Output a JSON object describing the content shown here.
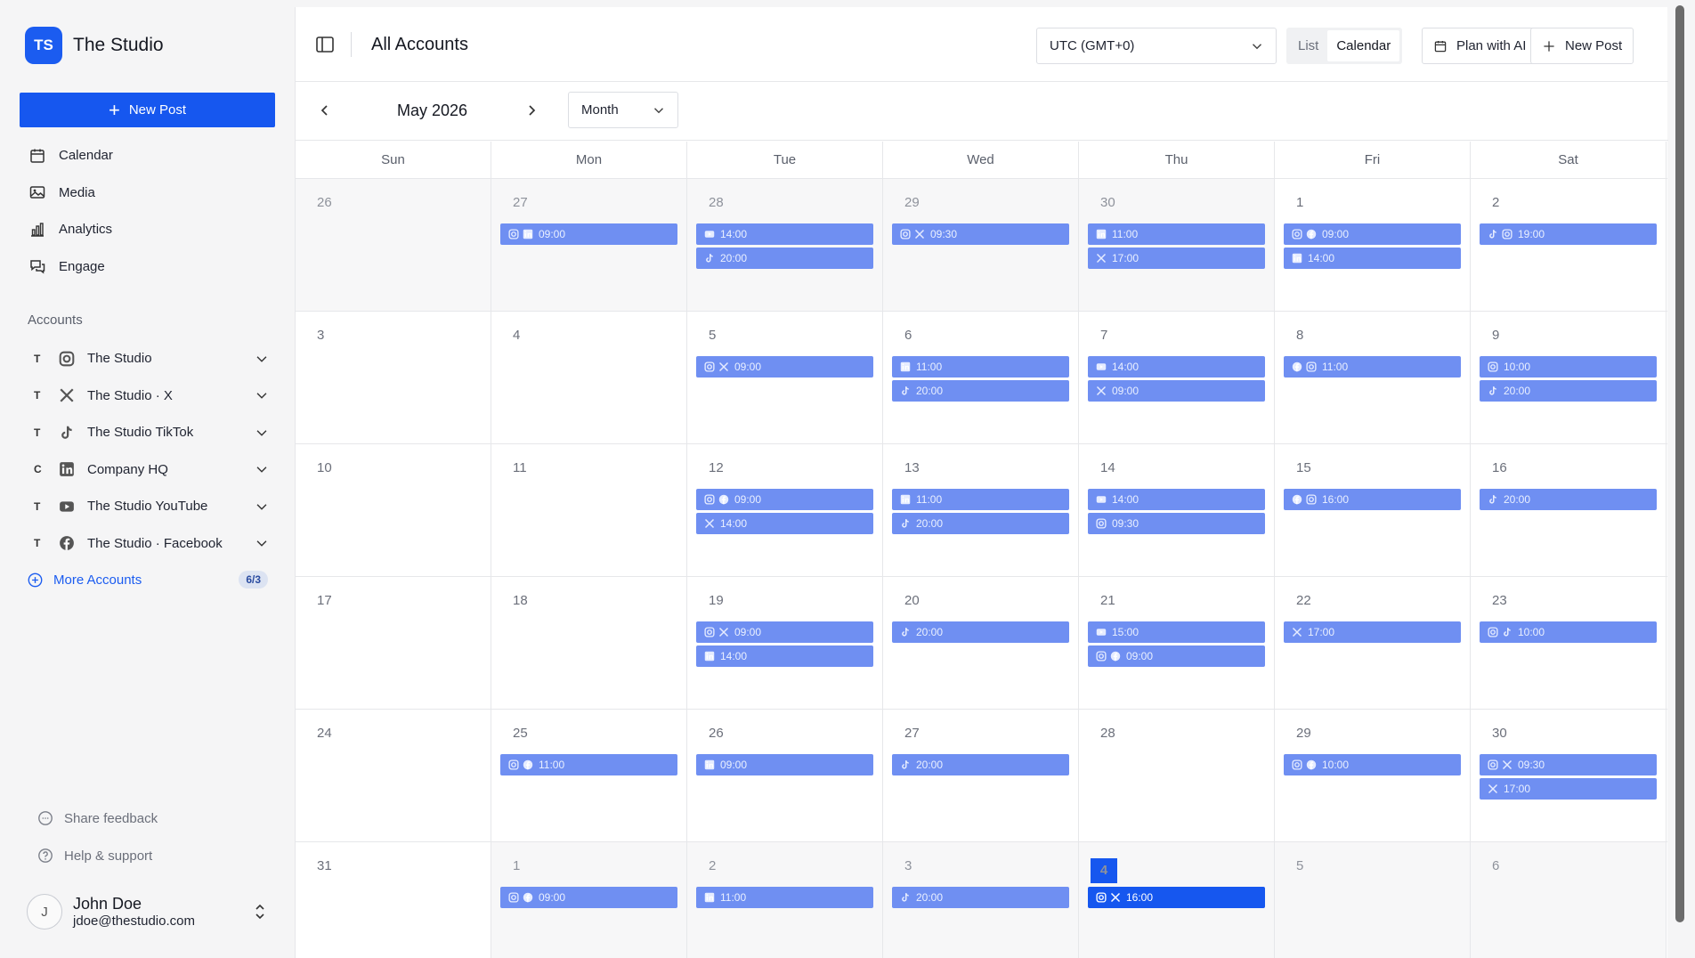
{
  "brand": {
    "initials": "TS",
    "name": "The Studio"
  },
  "sidebar": {
    "new_post_label": "New Post",
    "nav": [
      {
        "label": "Calendar",
        "icon": "calendar-icon"
      },
      {
        "label": "Media",
        "icon": "image-icon"
      },
      {
        "label": "Analytics",
        "icon": "bar-chart-icon"
      },
      {
        "label": "Engage",
        "icon": "chat-icon"
      }
    ],
    "accounts_title": "Accounts",
    "accounts": [
      {
        "letter": "T",
        "platform": "instagram",
        "name": "The Studio"
      },
      {
        "letter": "T",
        "platform": "x",
        "name": "The Studio · X"
      },
      {
        "letter": "T",
        "platform": "tiktok",
        "name": "The Studio TikTok"
      },
      {
        "letter": "C",
        "platform": "linkedin",
        "name": "Company HQ"
      },
      {
        "letter": "T",
        "platform": "youtube",
        "name": "The Studio YouTube"
      },
      {
        "letter": "T",
        "platform": "facebook",
        "name": "The Studio · Facebook"
      }
    ],
    "more_accounts_label": "More Accounts",
    "more_accounts_count": "6/3",
    "share_feedback": "Share feedback",
    "help_support": "Help & support",
    "user": {
      "initial": "J",
      "name": "John Doe",
      "email": "jdoe@thestudio.com"
    }
  },
  "header": {
    "title": "All Accounts",
    "timezone": "UTC (GMT+0)",
    "view_list": "List",
    "view_calendar": "Calendar",
    "plan_ai_label": "Plan with AI",
    "new_post_label": "New Post"
  },
  "toolbar": {
    "month_label": "May 2026",
    "range": "Month"
  },
  "calendar": {
    "days_of_week": [
      "Sun",
      "Mon",
      "Tue",
      "Wed",
      "Thu",
      "Fri",
      "Sat"
    ],
    "weeks": [
      [
        {
          "n": "26",
          "muted": true,
          "events": []
        },
        {
          "n": "27",
          "muted": true,
          "events": [
            {
              "p": [
                "instagram",
                "linkedin"
              ],
              "t": "09:00"
            }
          ]
        },
        {
          "n": "28",
          "muted": true,
          "events": [
            {
              "p": [
                "youtube"
              ],
              "t": "14:00"
            },
            {
              "p": [
                "tiktok"
              ],
              "t": "20:00"
            }
          ]
        },
        {
          "n": "29",
          "muted": true,
          "events": [
            {
              "p": [
                "instagram",
                "x"
              ],
              "t": "09:30"
            }
          ]
        },
        {
          "n": "30",
          "muted": true,
          "events": [
            {
              "p": [
                "linkedin"
              ],
              "t": "11:00"
            },
            {
              "p": [
                "x"
              ],
              "t": "17:00"
            }
          ]
        },
        {
          "n": "1",
          "events": [
            {
              "p": [
                "instagram",
                "facebook"
              ],
              "t": "09:00"
            },
            {
              "p": [
                "linkedin"
              ],
              "t": "14:00"
            }
          ]
        },
        {
          "n": "2",
          "events": [
            {
              "p": [
                "tiktok",
                "instagram"
              ],
              "t": "19:00"
            }
          ]
        }
      ],
      [
        {
          "n": "3",
          "events": []
        },
        {
          "n": "4",
          "events": []
        },
        {
          "n": "5",
          "events": [
            {
              "p": [
                "instagram",
                "x"
              ],
              "t": "09:00"
            }
          ]
        },
        {
          "n": "6",
          "events": [
            {
              "p": [
                "linkedin"
              ],
              "t": "11:00"
            },
            {
              "p": [
                "tiktok"
              ],
              "t": "20:00"
            }
          ]
        },
        {
          "n": "7",
          "events": [
            {
              "p": [
                "youtube"
              ],
              "t": "14:00"
            },
            {
              "p": [
                "x"
              ],
              "t": "09:00"
            }
          ]
        },
        {
          "n": "8",
          "events": [
            {
              "p": [
                "facebook",
                "instagram"
              ],
              "t": "11:00"
            }
          ]
        },
        {
          "n": "9",
          "events": [
            {
              "p": [
                "instagram"
              ],
              "t": "10:00"
            },
            {
              "p": [
                "tiktok"
              ],
              "t": "20:00"
            }
          ]
        }
      ],
      [
        {
          "n": "10",
          "events": []
        },
        {
          "n": "11",
          "events": []
        },
        {
          "n": "12",
          "events": [
            {
              "p": [
                "instagram",
                "facebook"
              ],
              "t": "09:00"
            },
            {
              "p": [
                "x"
              ],
              "t": "14:00"
            }
          ]
        },
        {
          "n": "13",
          "events": [
            {
              "p": [
                "linkedin"
              ],
              "t": "11:00"
            },
            {
              "p": [
                "tiktok"
              ],
              "t": "20:00"
            }
          ]
        },
        {
          "n": "14",
          "events": [
            {
              "p": [
                "youtube"
              ],
              "t": "14:00"
            },
            {
              "p": [
                "instagram"
              ],
              "t": "09:30"
            }
          ]
        },
        {
          "n": "15",
          "events": [
            {
              "p": [
                "facebook",
                "instagram"
              ],
              "t": "16:00"
            }
          ]
        },
        {
          "n": "16",
          "events": [
            {
              "p": [
                "tiktok"
              ],
              "t": "20:00"
            }
          ]
        }
      ],
      [
        {
          "n": "17",
          "events": []
        },
        {
          "n": "18",
          "events": []
        },
        {
          "n": "19",
          "events": [
            {
              "p": [
                "instagram",
                "x"
              ],
              "t": "09:00"
            },
            {
              "p": [
                "linkedin"
              ],
              "t": "14:00"
            }
          ]
        },
        {
          "n": "20",
          "events": [
            {
              "p": [
                "tiktok"
              ],
              "t": "20:00"
            }
          ]
        },
        {
          "n": "21",
          "events": [
            {
              "p": [
                "youtube"
              ],
              "t": "15:00"
            },
            {
              "p": [
                "instagram",
                "facebook"
              ],
              "t": "09:00"
            }
          ]
        },
        {
          "n": "22",
          "events": [
            {
              "p": [
                "x"
              ],
              "t": "17:00"
            }
          ]
        },
        {
          "n": "23",
          "events": [
            {
              "p": [
                "instagram",
                "tiktok"
              ],
              "t": "10:00"
            }
          ]
        }
      ],
      [
        {
          "n": "24",
          "events": []
        },
        {
          "n": "25",
          "events": [
            {
              "p": [
                "instagram",
                "facebook"
              ],
              "t": "11:00"
            }
          ]
        },
        {
          "n": "26",
          "events": [
            {
              "p": [
                "linkedin"
              ],
              "t": "09:00"
            }
          ]
        },
        {
          "n": "27",
          "events": [
            {
              "p": [
                "tiktok"
              ],
              "t": "20:00"
            }
          ]
        },
        {
          "n": "28",
          "events": []
        },
        {
          "n": "29",
          "events": [
            {
              "p": [
                "instagram",
                "facebook"
              ],
              "t": "10:00"
            }
          ]
        },
        {
          "n": "30",
          "events": [
            {
              "p": [
                "instagram",
                "x"
              ],
              "t": "09:30"
            },
            {
              "p": [
                "x"
              ],
              "t": "17:00"
            }
          ]
        }
      ],
      [
        {
          "n": "31",
          "events": []
        },
        {
          "n": "1",
          "muted": true,
          "events": [
            {
              "p": [
                "instagram",
                "facebook"
              ],
              "t": "09:00"
            }
          ]
        },
        {
          "n": "2",
          "muted": true,
          "events": [
            {
              "p": [
                "linkedin"
              ],
              "t": "11:00"
            }
          ]
        },
        {
          "n": "3",
          "muted": true,
          "events": [
            {
              "p": [
                "tiktok"
              ],
              "t": "20:00"
            }
          ]
        },
        {
          "n": "4",
          "muted": true,
          "today": true,
          "events": [
            {
              "p": [
                "instagram",
                "x"
              ],
              "t": "16:00",
              "current": true
            }
          ]
        },
        {
          "n": "5",
          "muted": true,
          "events": []
        },
        {
          "n": "6",
          "muted": true,
          "events": []
        }
      ]
    ]
  },
  "colors": {
    "accent": "#1657ef",
    "event": "#6f8ff2"
  }
}
